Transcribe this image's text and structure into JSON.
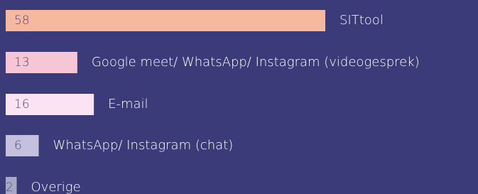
{
  "colors": {
    "background": "#3a3b78",
    "bars": [
      "#f7b8a0",
      "#f6c5d6",
      "#fae3f2",
      "#c5c0dd",
      "#a8a8c6"
    ],
    "category_text": "#ffffff",
    "value_text": "#4b4a7b"
  },
  "chart_data": {
    "type": "bar",
    "orientation": "horizontal",
    "categories": [
      "SITtool",
      "Google meet/ WhatsApp/ Instagram (videogesprek)",
      "E-mail",
      "WhatsApp/ Instagram (chat)",
      "Overige"
    ],
    "values": [
      58,
      13,
      16,
      6,
      2
    ],
    "value_labels": [
      "58",
      "13",
      "16",
      "6",
      "2"
    ],
    "title": "",
    "xlabel": "",
    "ylabel": "",
    "xlim": [
      0,
      58
    ],
    "grid": false,
    "legend": "none"
  }
}
